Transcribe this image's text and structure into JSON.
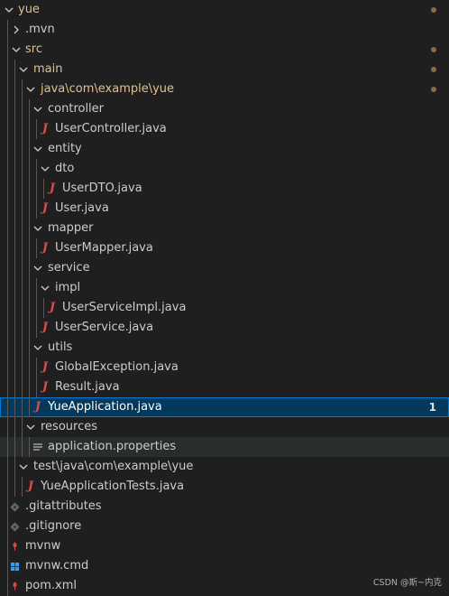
{
  "tree": [
    {
      "label": "yue",
      "type": "folder",
      "expanded": true,
      "modified": true
    },
    {
      "label": ".mvn",
      "type": "folder",
      "expanded": false
    },
    {
      "label": "src",
      "type": "folder",
      "expanded": true,
      "modified": true
    },
    {
      "label": "main",
      "type": "folder",
      "expanded": true,
      "modified": true
    },
    {
      "label": "java\\com\\example\\yue",
      "type": "folder",
      "expanded": true,
      "modified": true
    },
    {
      "label": "controller",
      "type": "folder",
      "expanded": true
    },
    {
      "label": "UserController.java",
      "type": "java"
    },
    {
      "label": "entity",
      "type": "folder",
      "expanded": true
    },
    {
      "label": "dto",
      "type": "folder",
      "expanded": true
    },
    {
      "label": "UserDTO.java",
      "type": "java"
    },
    {
      "label": "User.java",
      "type": "java"
    },
    {
      "label": "mapper",
      "type": "folder",
      "expanded": true
    },
    {
      "label": "UserMapper.java",
      "type": "java"
    },
    {
      "label": "service",
      "type": "folder",
      "expanded": true
    },
    {
      "label": "impl",
      "type": "folder",
      "expanded": true
    },
    {
      "label": "UserServiceImpl.java",
      "type": "java"
    },
    {
      "label": "UserService.java",
      "type": "java"
    },
    {
      "label": "utils",
      "type": "folder",
      "expanded": true
    },
    {
      "label": "GlobalException.java",
      "type": "java"
    },
    {
      "label": "Result.java",
      "type": "java"
    },
    {
      "label": "YueApplication.java",
      "type": "java",
      "selected": true,
      "badge": "1"
    },
    {
      "label": "resources",
      "type": "folder",
      "expanded": false
    },
    {
      "label": "application.properties",
      "type": "properties",
      "hover": true
    },
    {
      "label": "test\\java\\com\\example\\yue",
      "type": "folder",
      "expanded": true
    },
    {
      "label": "YueApplicationTests.java",
      "type": "java"
    },
    {
      "label": ".gitattributes",
      "type": "git"
    },
    {
      "label": ".gitignore",
      "type": "git"
    },
    {
      "label": "mvnw",
      "type": "mvnw"
    },
    {
      "label": "mvnw.cmd",
      "type": "windows"
    },
    {
      "label": "pom.xml",
      "type": "maven"
    }
  ],
  "watermark": "CSDN @斯~内克"
}
